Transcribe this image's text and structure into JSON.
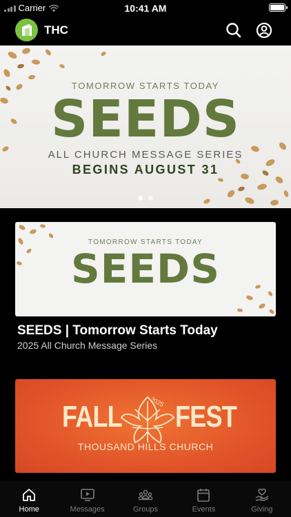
{
  "status_bar": {
    "carrier": "Carrier",
    "time": "10:41 AM"
  },
  "header": {
    "title": "THC",
    "logo_color": "#7cc242"
  },
  "hero": {
    "kicker": "TOMORROW STARTS TODAY",
    "title": "SEEDS",
    "subtitle": "ALL CHURCH MESSAGE SERIES",
    "date": "BEGINS AUGUST 31",
    "slide_count": 2,
    "active_slide": 1
  },
  "cards": [
    {
      "image_kicker": "TOMORROW STARTS TODAY",
      "image_title": "SEEDS",
      "title": "SEEDS | Tomorrow Starts Today",
      "subtitle": "2025 All Church Message Series"
    },
    {
      "image_left": "FALL",
      "image_right": "FEST",
      "image_year": "2025",
      "image_church": "THOUSAND HILLS CHURCH"
    }
  ],
  "tabs": [
    {
      "label": "Home",
      "icon": "home-icon",
      "active": true
    },
    {
      "label": "Messages",
      "icon": "play-tv-icon",
      "active": false
    },
    {
      "label": "Groups",
      "icon": "groups-icon",
      "active": false
    },
    {
      "label": "Events",
      "icon": "calendar-icon",
      "active": false
    },
    {
      "label": "Giving",
      "icon": "giving-hand-icon",
      "active": false
    }
  ],
  "colors": {
    "accent_green": "#64793d",
    "fall_orange": "#e2552a",
    "tab_inactive": "#7c7c7c"
  }
}
